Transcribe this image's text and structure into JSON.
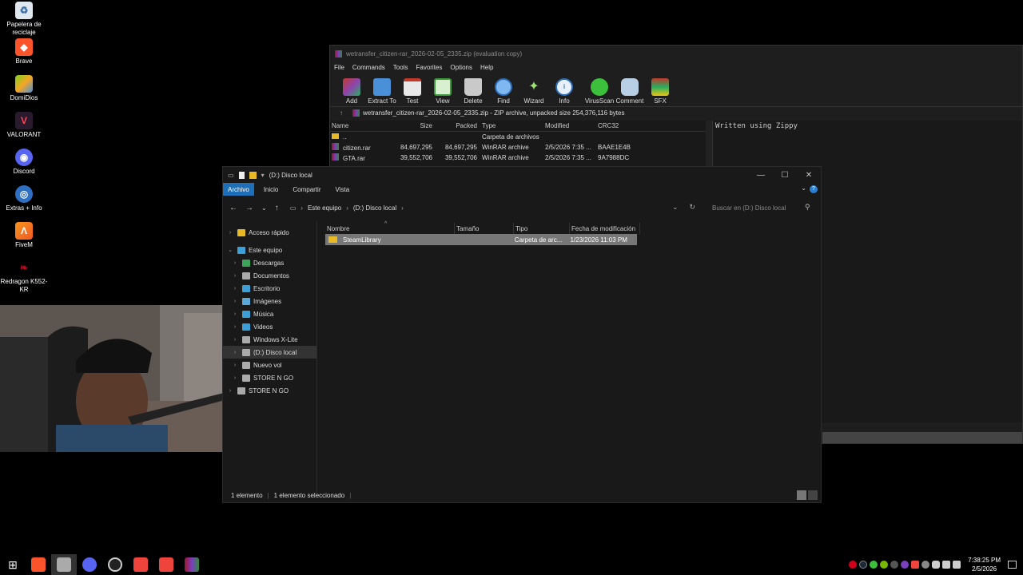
{
  "desktop": {
    "icons": [
      {
        "label": "Papelera de reciclaje",
        "icon": "recycle-bin-icon"
      },
      {
        "label": "Brave",
        "icon": "brave-icon"
      },
      {
        "label": "DomiDios",
        "icon": "bluestacks-icon"
      },
      {
        "label": "VALORANT",
        "icon": "valorant-icon"
      },
      {
        "label": "Discord",
        "icon": "discord-icon"
      },
      {
        "label": "Extras + Info",
        "icon": "globe-icon"
      },
      {
        "label": "FiveM",
        "icon": "fivem-icon"
      },
      {
        "label": "Redragon K552-KR",
        "icon": "redragon-icon"
      }
    ]
  },
  "winrar": {
    "title": "wetransfer_citizen-rar_2026-02-05_2335.zip (evaluation copy)",
    "menu": [
      "File",
      "Commands",
      "Tools",
      "Favorites",
      "Options",
      "Help"
    ],
    "toolbar": [
      "Add",
      "Extract To",
      "Test",
      "View",
      "Delete",
      "Find",
      "Wizard",
      "Info",
      "VirusScan",
      "Comment",
      "SFX"
    ],
    "path": "wetransfer_citizen-rar_2026-02-05_2335.zip - ZIP archive, unpacked size 254,376,116 bytes",
    "columns": [
      "Name",
      "Size",
      "Packed",
      "Type",
      "Modified",
      "CRC32"
    ],
    "rows": [
      {
        "name": "..",
        "size": "",
        "packed": "",
        "type": "Carpeta de archivos",
        "modified": "",
        "crc": ""
      },
      {
        "name": "citizen.rar",
        "size": "84,697,295",
        "packed": "84,697,295",
        "type": "WinRAR archive",
        "modified": "2/5/2026 7:35 ...",
        "crc": "BAAE1E4B"
      },
      {
        "name": "GTA.rar",
        "size": "39,552,706",
        "packed": "39,552,706",
        "type": "WinRAR archive",
        "modified": "2/5/2026 7:35 ...",
        "crc": "9A7988DC"
      }
    ],
    "comment": "Written using Zippy"
  },
  "explorer": {
    "title": "(D:) Disco local",
    "ribbon": [
      "Archivo",
      "Inicio",
      "Compartir",
      "Vista"
    ],
    "breadcrumb": [
      "Este equipo",
      "(D:) Disco local"
    ],
    "search_placeholder": "Buscar en (D:) Disco local",
    "nav": [
      {
        "label": "Acceso rápido",
        "indent": 0,
        "color": "#e8b923"
      },
      {
        "label": "Este equipo",
        "indent": 0,
        "color": "#3b9fd8"
      },
      {
        "label": "Descargas",
        "indent": 1,
        "color": "#3aa55b"
      },
      {
        "label": "Documentos",
        "indent": 1,
        "color": "#aaaaaa"
      },
      {
        "label": "Escritorio",
        "indent": 1,
        "color": "#3b9fd8"
      },
      {
        "label": "Imágenes",
        "indent": 1,
        "color": "#5aa8d8"
      },
      {
        "label": "Música",
        "indent": 1,
        "color": "#3b9fd8"
      },
      {
        "label": "Videos",
        "indent": 1,
        "color": "#3b9fd8"
      },
      {
        "label": "Windows X-Lite",
        "indent": 1,
        "color": "#aaaaaa"
      },
      {
        "label": "(D:) Disco local",
        "indent": 1,
        "color": "#aaaaaa"
      },
      {
        "label": "Nuevo vol",
        "indent": 1,
        "color": "#aaaaaa"
      },
      {
        "label": "STORE N GO",
        "indent": 1,
        "color": "#aaaaaa"
      },
      {
        "label": "STORE N GO",
        "indent": 0,
        "color": "#aaaaaa"
      }
    ],
    "columns": [
      "Nombre",
      "Tamaño",
      "Tipo",
      "Fecha de modificación"
    ],
    "rows": [
      {
        "name": "SteamLibrary",
        "size": "",
        "type": "Carpeta de arc...",
        "date": "1/23/2026 11:03 PM"
      }
    ],
    "status_count": "1 elemento",
    "status_selected": "1 elemento seleccionado"
  },
  "taskbar": {
    "apps": [
      "windows-start-icon",
      "brave-icon",
      "file-explorer-icon",
      "discord-icon",
      "obs-icon",
      "anydesk-icon",
      "anydesk-icon",
      "winrar-icon"
    ],
    "time": "7:38:25 PM",
    "date": "2/5/2026"
  }
}
